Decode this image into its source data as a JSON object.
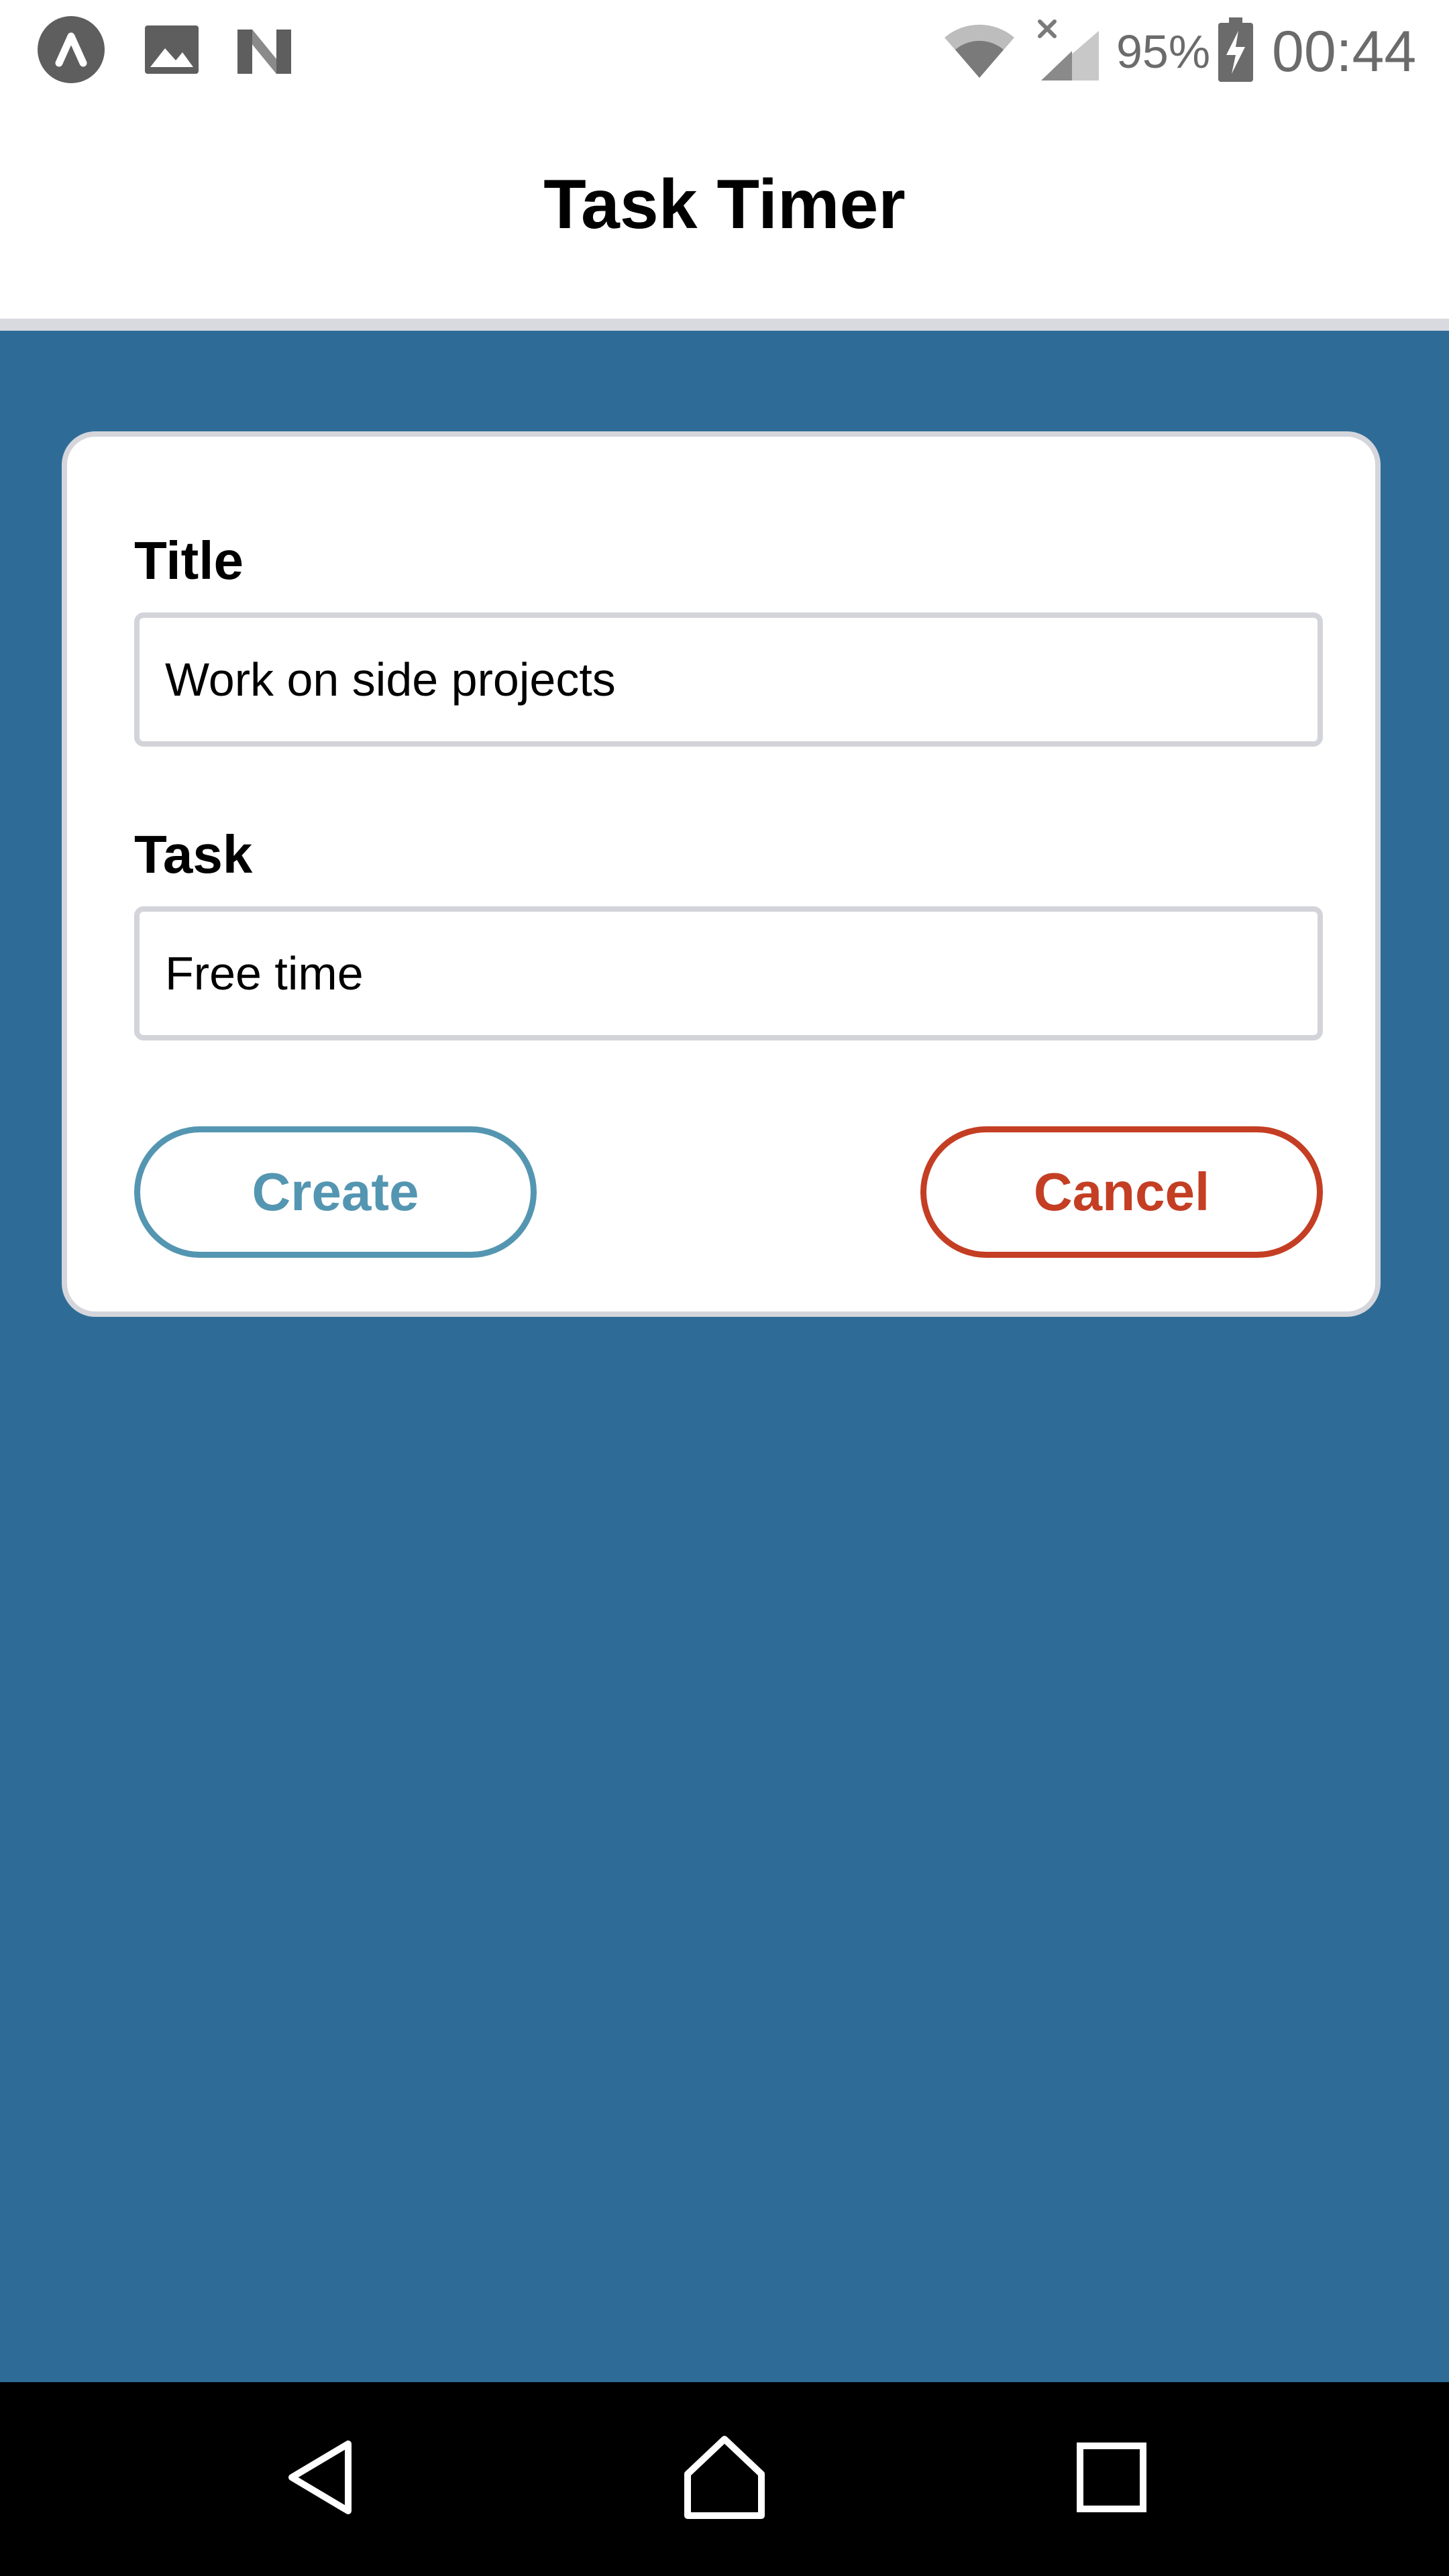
{
  "status_bar": {
    "notification_icons": [
      "app-logo-icon",
      "image-icon",
      "n-logo-icon"
    ],
    "wifi_icon": "wifi-icon",
    "signal_icon": "signal-off-icon",
    "battery_percent": "95%",
    "battery_icon": "battery-charging-icon",
    "time": "00:44"
  },
  "header": {
    "title": "Task Timer"
  },
  "form": {
    "title_label": "Title",
    "title_value": "Work on side projects",
    "task_label": "Task",
    "task_value": "Free time",
    "create_label": "Create",
    "cancel_label": "Cancel"
  },
  "nav_bar": {
    "back_icon": "back-triangle-icon",
    "home_icon": "home-icon",
    "recents_icon": "recents-square-icon"
  },
  "colors": {
    "background": "#2e6c97",
    "create_accent": "#5496b1",
    "cancel_accent": "#c43e23"
  }
}
